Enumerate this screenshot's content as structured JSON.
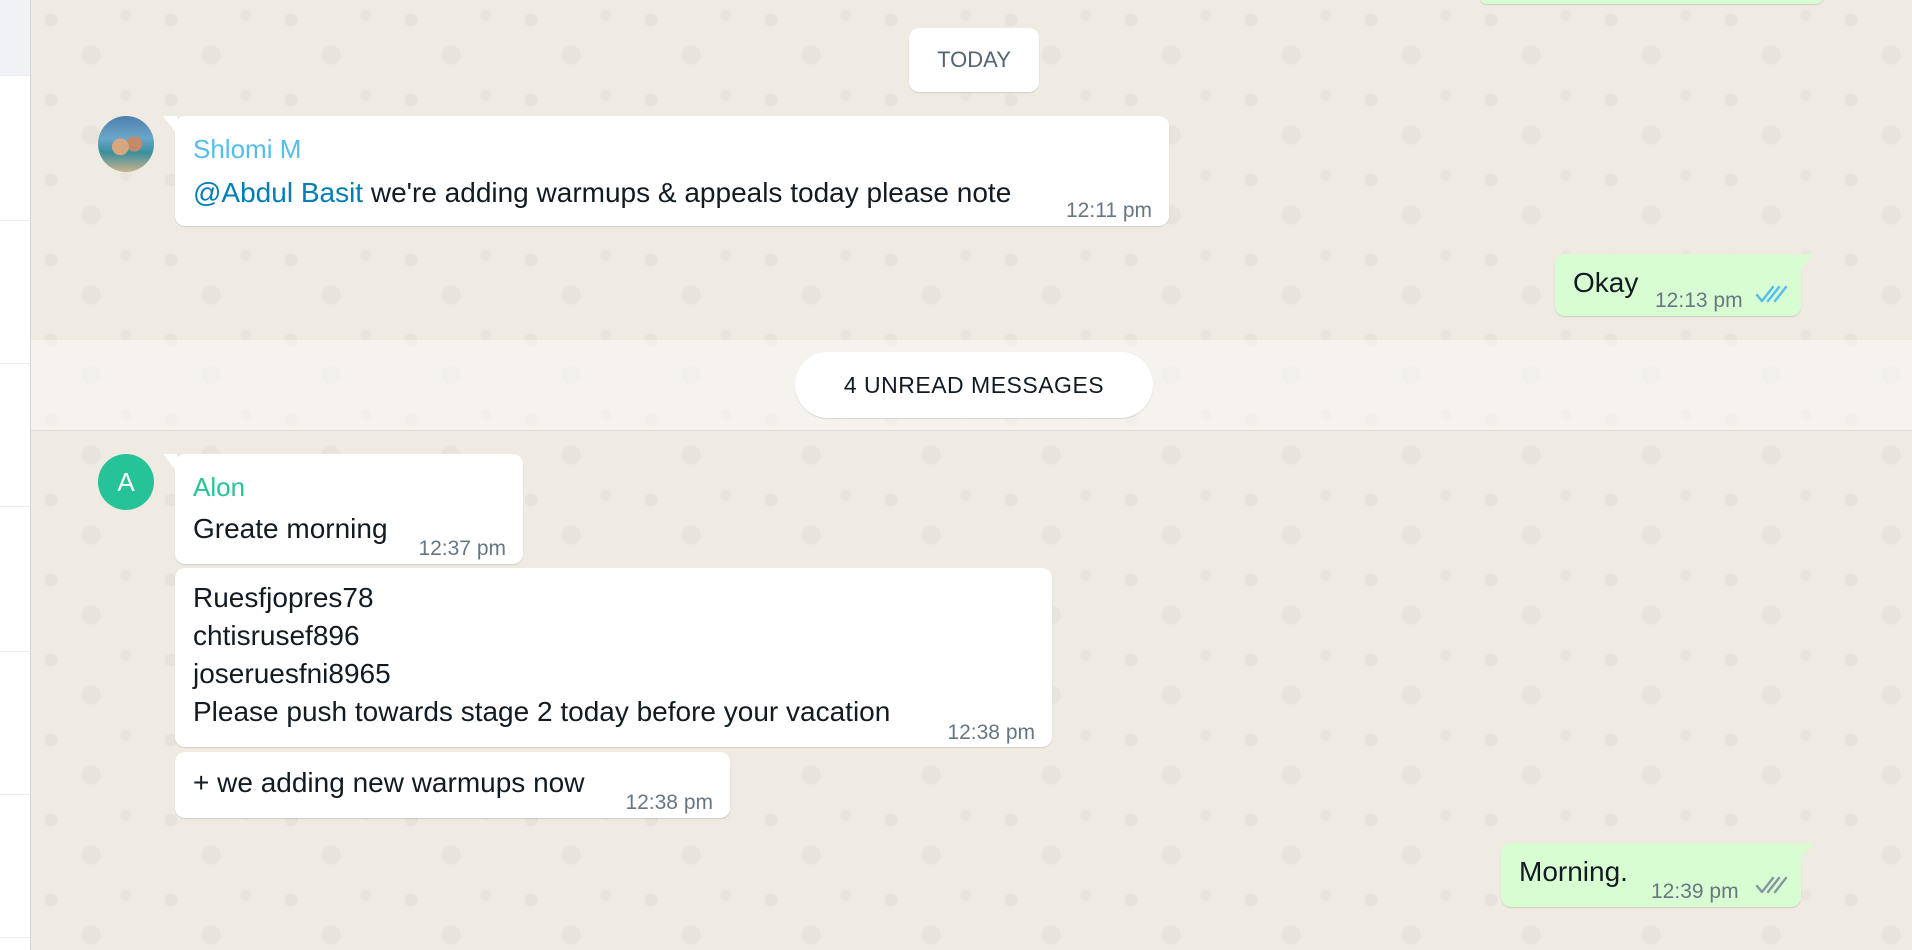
{
  "divider_today": "TODAY",
  "unread_divider": "4 UNREAD MESSAGES",
  "messages": [
    {
      "sender": "Shlomi M",
      "sender_color": "#53bdeb",
      "mention": "@Abdul Basit",
      "text": " we're adding warmups & appeals today please note",
      "time": "12:11 pm"
    },
    {
      "text": "Okay",
      "time": "12:13 pm",
      "status": "read",
      "tick_color": "#53bdeb"
    },
    {
      "sender": "Alon",
      "sender_color": "#25c397",
      "avatar_letter": "A",
      "text": "Greate morning",
      "time": "12:37 pm"
    },
    {
      "lines": [
        "Ruesfjopres78",
        "chtisrusef896",
        "joseruesfni8965",
        "Please push towards stage 2 today before your vacation"
      ],
      "time": "12:38 pm"
    },
    {
      "text": "+ we adding new warmups now",
      "time": "12:38 pm"
    },
    {
      "text": "Morning.",
      "time": "12:39 pm",
      "status": "delivered",
      "tick_color": "#8696a0"
    }
  ],
  "icons": {
    "read_ticks": "double-check-icon",
    "delivered_ticks": "double-check-icon",
    "avatar_photo": "contact-avatar"
  }
}
